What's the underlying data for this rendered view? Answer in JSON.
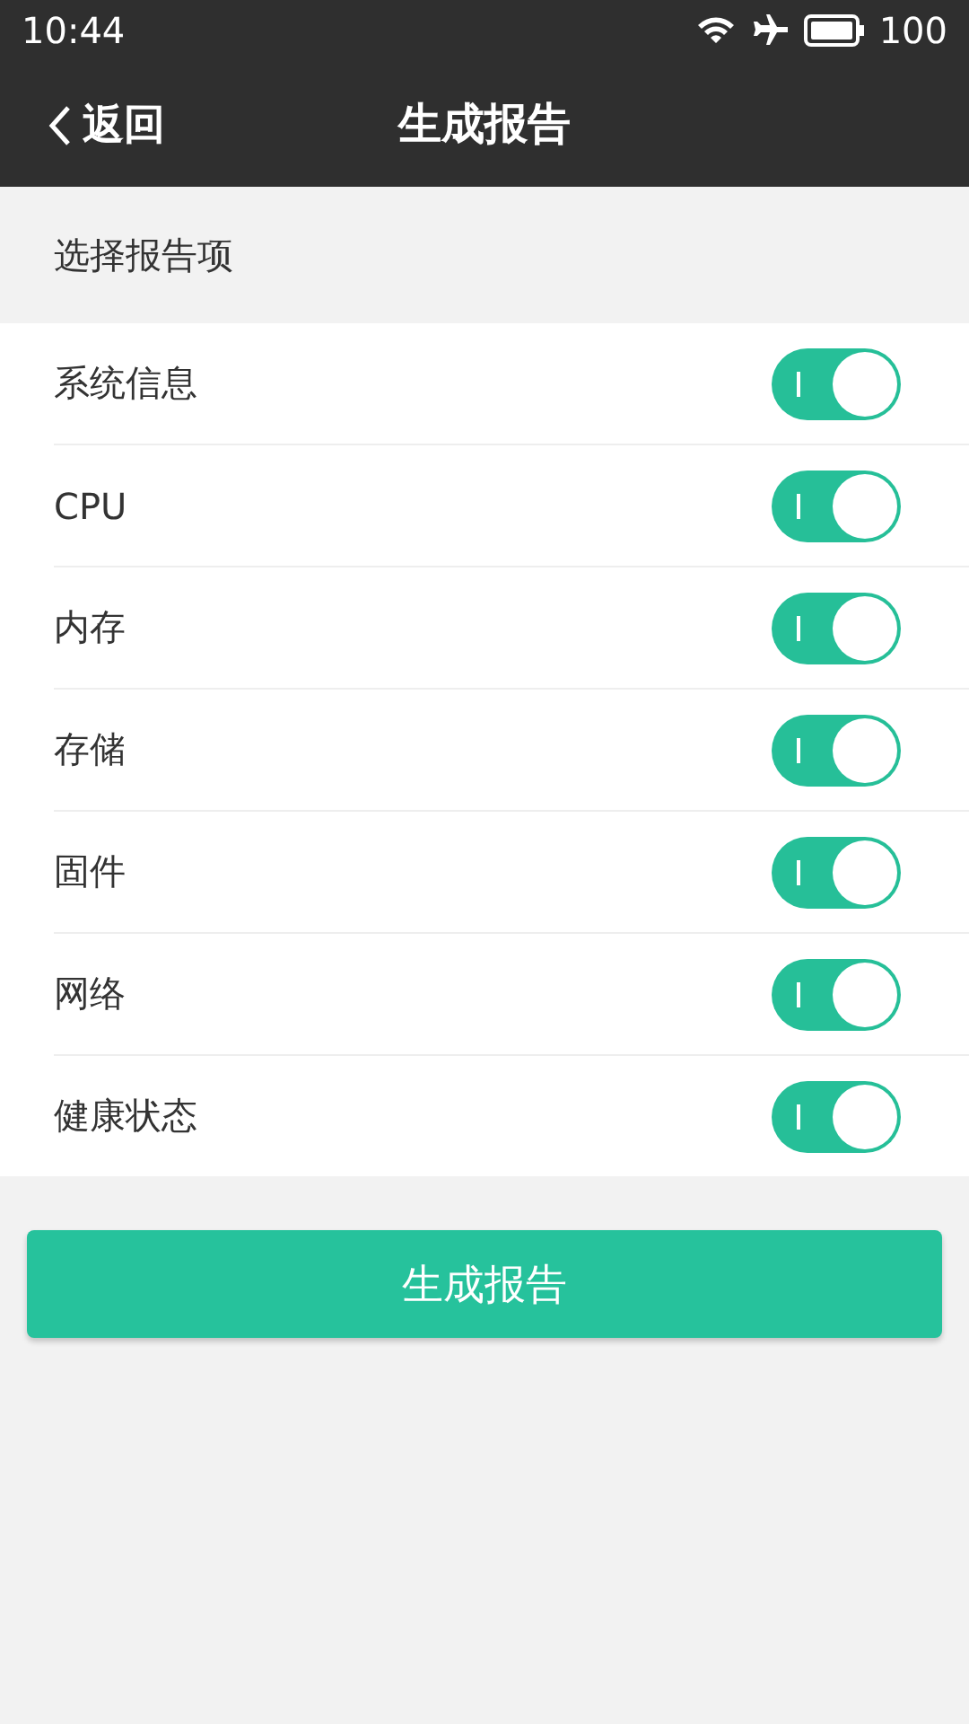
{
  "status_bar": {
    "time": "10:44",
    "battery": "100"
  },
  "header": {
    "back": "返回",
    "title": "生成报告"
  },
  "section": {
    "title": "选择报告项"
  },
  "items": [
    {
      "label": "系统信息",
      "on": true
    },
    {
      "label": "CPU",
      "on": true
    },
    {
      "label": "内存",
      "on": true
    },
    {
      "label": "存储",
      "on": true
    },
    {
      "label": "固件",
      "on": true
    },
    {
      "label": "网络",
      "on": true
    },
    {
      "label": "健康状态",
      "on": true
    }
  ],
  "button": "生成报告"
}
